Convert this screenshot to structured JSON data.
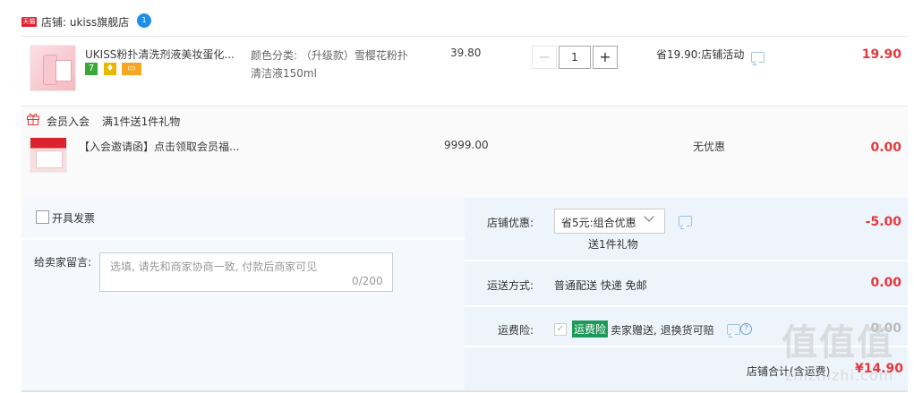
{
  "shop": {
    "badge": "天猫",
    "name": "店铺: ukiss旗舰店",
    "ww_badge": "1"
  },
  "items": [
    {
      "title": "UKISS粉扑清洗剂液美妆蛋化...",
      "sku_line1": "颜色分类: （升级款）雪樱花粉扑",
      "sku_line2": "清洁液150ml",
      "price": "39.80",
      "quantity": "1",
      "minus": "−",
      "plus": "+",
      "promo": "省19.90:店铺活动",
      "subtotal": "19.90",
      "tags": [
        "7",
        "♦",
        "▭"
      ]
    },
    {
      "title": "【入会邀请函】点击领取会员福...",
      "price": "9999.00",
      "discount": "无优惠",
      "subtotal": "0.00"
    }
  ],
  "gift_section": {
    "label": "会员入会",
    "rule": "满1件送1件礼物"
  },
  "order": {
    "invoice_label": "开具发票",
    "memo_label": "给卖家留言:",
    "memo_placeholder": "选填, 请先和商家协商一致, 付款后商家可见",
    "memo_count": "0/200",
    "coupon_label": "店铺优惠:",
    "coupon_selected": "省5元:组合优惠",
    "coupon_note": "送1件礼物",
    "coupon_amount": "-5.00",
    "shipping_label": "运送方式:",
    "shipping_value": "普通配送 快递 免邮",
    "shipping_amount": "0.00",
    "insurance_label": "运费险:",
    "insurance_badge": "运费险",
    "insurance_text": "卖家赠送, 退换货可赔",
    "insurance_amount": "0.00",
    "total_label": "店铺合计(含运费)",
    "total_value": "¥14.90"
  },
  "watermark": {
    "big": "值值值",
    "small": "zhizhizhi.com"
  },
  "colors": {
    "price_red": "#e4393c",
    "tmall_red": "#e5202e",
    "insurance_green": "#1d9a58",
    "panel_bg": "#f5f8fc"
  }
}
